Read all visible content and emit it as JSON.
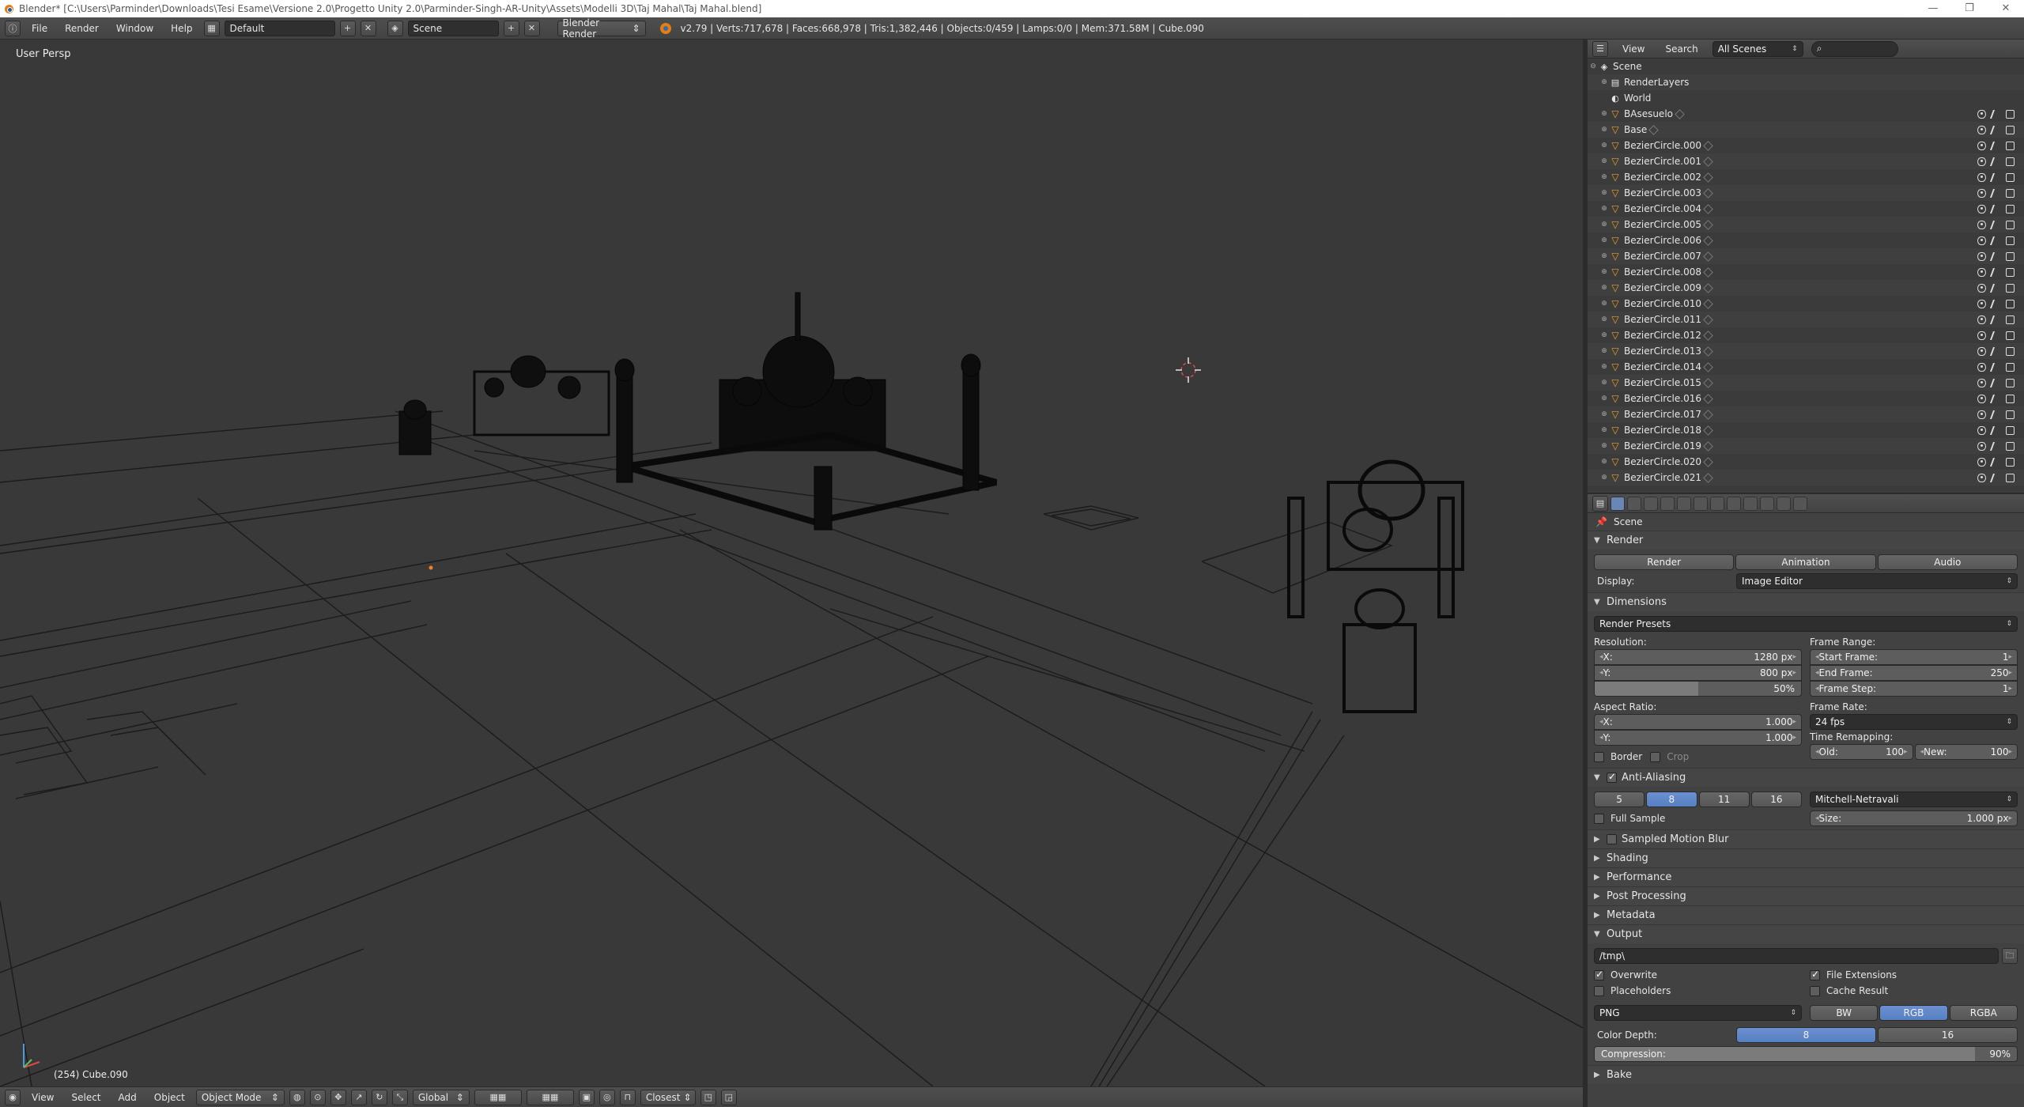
{
  "window": {
    "title": "Blender* [C:\\Users\\Parminder\\Downloads\\Tesi Esame\\Versione 2.0\\Progetto Unity 2.0\\Parminder-Singh-AR-Unity\\Assets\\Modelli 3D\\Taj Mahal\\Taj Mahal.blend]",
    "min": "—",
    "max": "❐",
    "close": "✕"
  },
  "info": {
    "menus": [
      "File",
      "Render",
      "Window",
      "Help"
    ],
    "layout": "Default",
    "scene": "Scene",
    "engine": "Blender Render",
    "stats": "v2.79 | Verts:717,678 | Faces:668,978 | Tris:1,382,446 | Objects:0/459 | Lamps:0/0 | Mem:371.58M | Cube.090"
  },
  "viewport": {
    "view_label": "User Persp",
    "object_label": "(254) Cube.090"
  },
  "v3d_header": {
    "menus": [
      "View",
      "Select",
      "Add",
      "Object"
    ],
    "mode": "Object Mode",
    "orientation": "Global",
    "snap": "Closest"
  },
  "outliner": {
    "menus": [
      "View",
      "Search"
    ],
    "filter": "All Scenes",
    "scene": "Scene",
    "render_layers": "RenderLayers",
    "world": "World",
    "objects": [
      "BAsesuelo",
      "Base",
      "BezierCircle.000",
      "BezierCircle.001",
      "BezierCircle.002",
      "BezierCircle.003",
      "BezierCircle.004",
      "BezierCircle.005",
      "BezierCircle.006",
      "BezierCircle.007",
      "BezierCircle.008",
      "BezierCircle.009",
      "BezierCircle.010",
      "BezierCircle.011",
      "BezierCircle.012",
      "BezierCircle.013",
      "BezierCircle.014",
      "BezierCircle.015",
      "BezierCircle.016",
      "BezierCircle.017",
      "BezierCircle.018",
      "BezierCircle.019",
      "BezierCircle.020",
      "BezierCircle.021"
    ]
  },
  "properties": {
    "breadcrumb": "Scene",
    "render": {
      "title": "Render",
      "render_btn": "Render",
      "animation_btn": "Animation",
      "audio_btn": "Audio",
      "display_label": "Display:",
      "display_value": "Image Editor"
    },
    "dimensions": {
      "title": "Dimensions",
      "presets": "Render Presets",
      "resolution_label": "Resolution:",
      "res_x_label": "X:",
      "res_x": "1280 px",
      "res_y_label": "Y:",
      "res_y": "800 px",
      "res_pct": "50%",
      "res_pct_value": 0.5,
      "aspect_label": "Aspect Ratio:",
      "asp_x_label": "X:",
      "asp_x": "1.000",
      "asp_y_label": "Y:",
      "asp_y": "1.000",
      "border": "Border",
      "crop": "Crop",
      "frame_range_label": "Frame Range:",
      "start_label": "Start Frame:",
      "start": "1",
      "end_label": "End Frame:",
      "end": "250",
      "step_label": "Frame Step:",
      "step": "1",
      "frame_rate_label": "Frame Rate:",
      "frame_rate": "24 fps",
      "remap_label": "Time Remapping:",
      "old_label": "Old:",
      "old": "100",
      "new_label": "New:",
      "new": "100"
    },
    "anti_aliasing": {
      "title": "Anti-Aliasing",
      "samples": [
        "5",
        "8",
        "11",
        "16"
      ],
      "filter": "Mitchell-Netravali",
      "full_sample": "Full Sample",
      "size_label": "Size:",
      "size": "1.000 px"
    },
    "collapsed": {
      "motion_blur": "Sampled Motion Blur",
      "shading": "Shading",
      "performance": "Performance",
      "post_processing": "Post Processing",
      "metadata": "Metadata"
    },
    "output": {
      "title": "Output",
      "path": "/tmp\\",
      "overwrite": "Overwrite",
      "file_extensions": "File Extensions",
      "placeholders": "Placeholders",
      "cache_result": "Cache Result",
      "format": "PNG",
      "color_modes": [
        "BW",
        "RGB",
        "RGBA"
      ],
      "color_depth_label": "Color Depth:",
      "depths": [
        "8",
        "16"
      ],
      "compression_label": "Compression:",
      "compression": "90%",
      "compression_value": 0.9
    },
    "bake": "Bake"
  }
}
